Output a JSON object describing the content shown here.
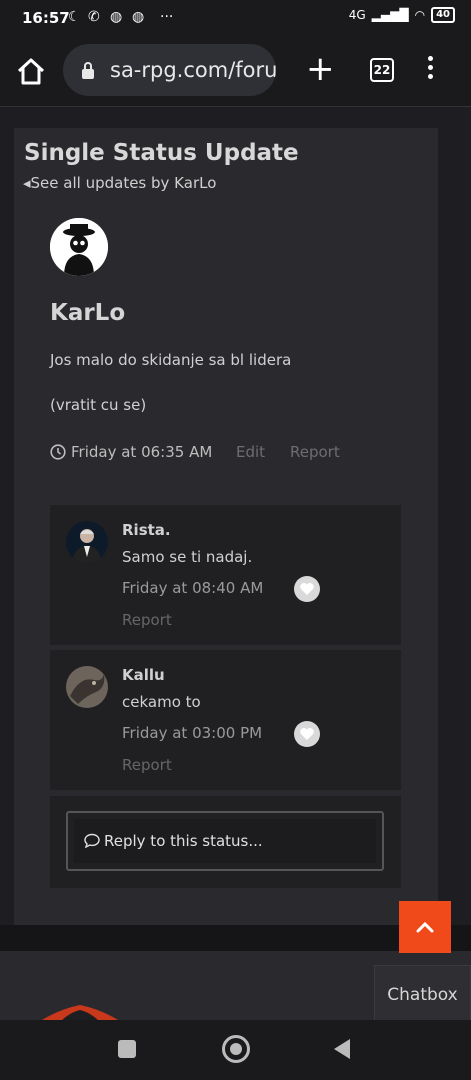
{
  "status_bar": {
    "time": "16:57",
    "network": "4G",
    "battery": "40"
  },
  "browser": {
    "url": "sa-rpg.com/forur",
    "tab_count": "22"
  },
  "page": {
    "title": "Single Status Update",
    "see_all": "See all updates by KarLo"
  },
  "status": {
    "author": "KarLo",
    "line1": "Jos malo do skidanje sa bl lidera",
    "line2": "(vratit cu se)",
    "time": "Friday at 06:35 AM",
    "edit_label": "Edit",
    "report_label": "Report"
  },
  "comments": [
    {
      "author": "Rista.",
      "text": "Samo se ti nadaj.",
      "time": "Friday at 08:40 AM",
      "report_label": "Report"
    },
    {
      "author": "Kallu",
      "text": "cekamo to",
      "time": "Friday at 03:00 PM",
      "report_label": "Report"
    }
  ],
  "reply": {
    "placeholder": "Reply to this status..."
  },
  "chatbox": {
    "label": "Chatbox"
  },
  "colors": {
    "accent": "#f04a1a",
    "panel": "#2a2a2e",
    "background": "#1e1e22"
  }
}
